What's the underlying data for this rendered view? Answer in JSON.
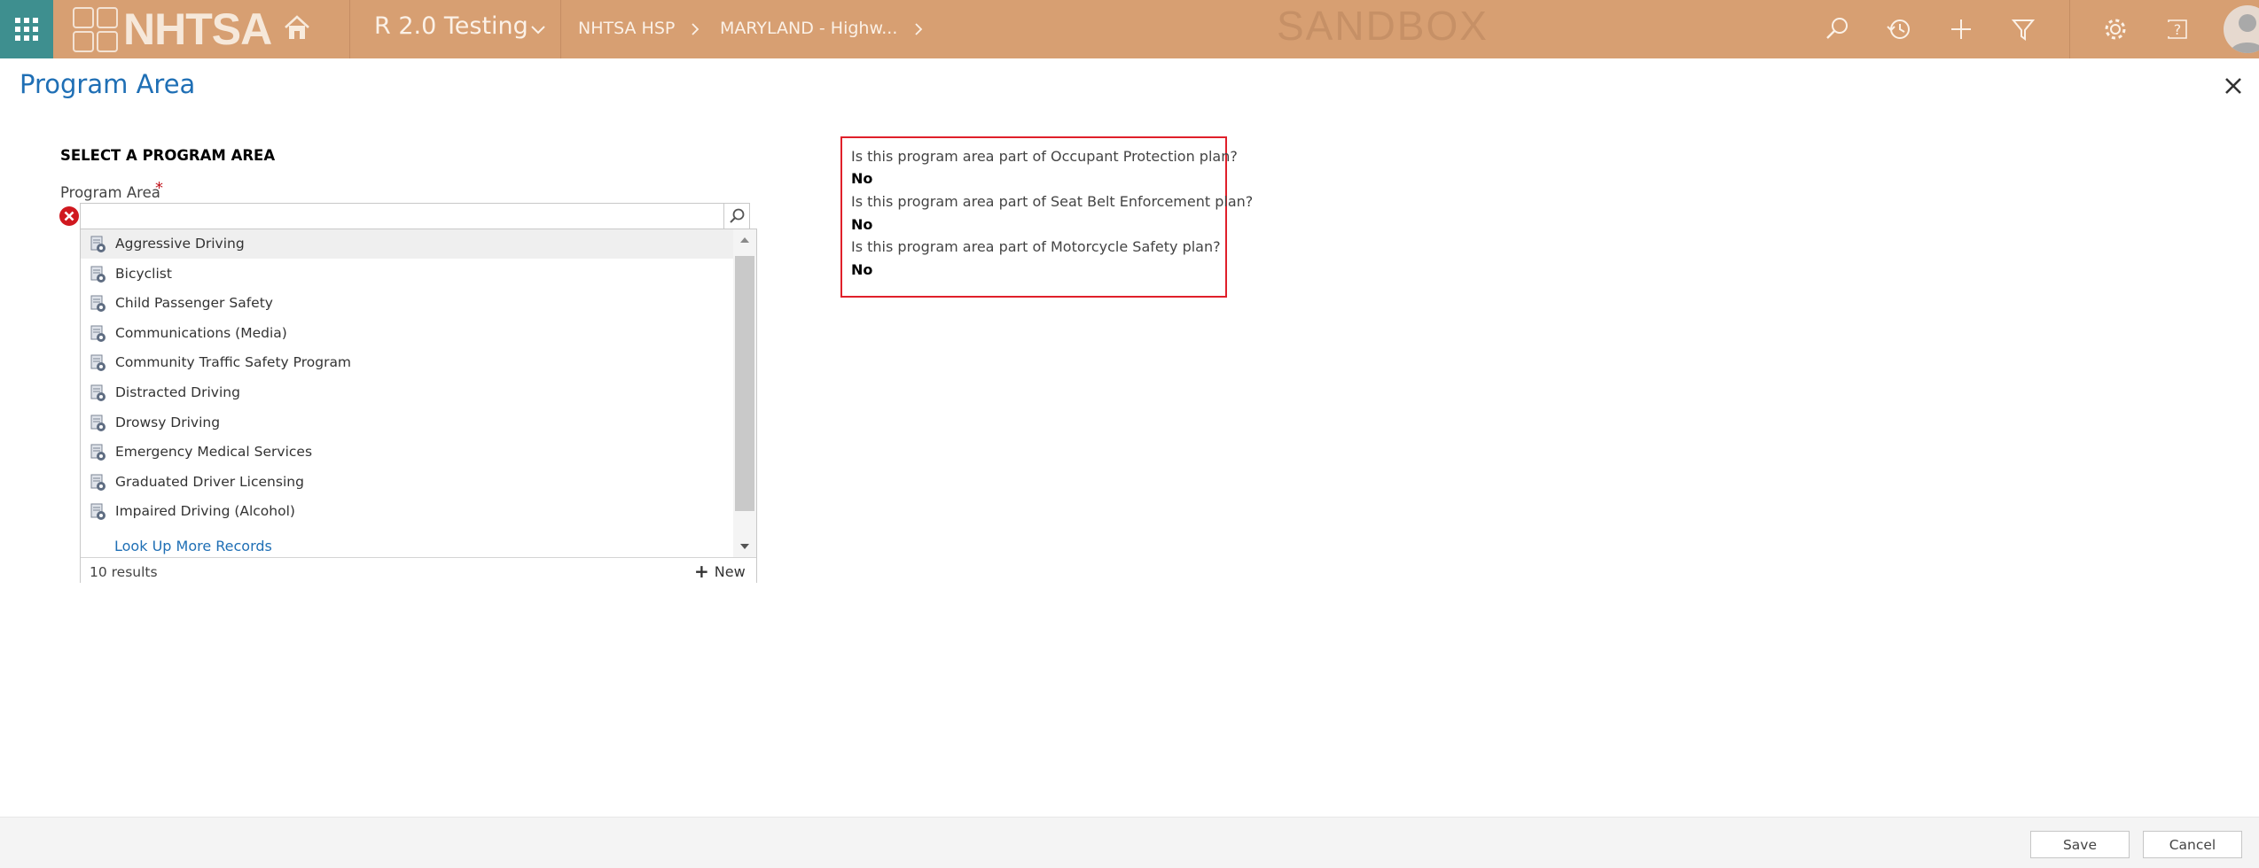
{
  "topbar": {
    "logo_text": "NHTSA",
    "app_title": "R 2.0 Testing",
    "breadcrumbs": [
      "NHTSA HSP",
      "MARYLAND - Highw..."
    ],
    "sandbox_label": "SANDBOX"
  },
  "dialog": {
    "title": "Program Area"
  },
  "form": {
    "section_heading": "SELECT A PROGRAM AREA",
    "field_label": "Program Area",
    "required_marker": "*",
    "input_value": ""
  },
  "lookup": {
    "items": [
      "Aggressive Driving",
      "Bicyclist",
      "Child Passenger Safety",
      "Communications (Media)",
      "Community Traffic Safety Program",
      "Distracted Driving",
      "Drowsy Driving",
      "Emergency Medical Services",
      "Graduated Driver Licensing",
      "Impaired Driving (Alcohol)"
    ],
    "look_up_more": "Look Up More Records",
    "results_count": "10 results",
    "new_label": "New"
  },
  "info": {
    "questions": [
      {
        "question": "Is this program area part of Occupant Protection plan?",
        "answer": "No"
      },
      {
        "question": "Is this program area part of Seat Belt Enforcement plan?",
        "answer": "No"
      },
      {
        "question": "Is this program area part of Motorcycle Safety plan?",
        "answer": "No"
      }
    ]
  },
  "footer": {
    "save_label": "Save",
    "cancel_label": "Cancel"
  },
  "colors": {
    "topbar": "#d79f72",
    "waffle": "#3e8f8f",
    "title_blue": "#1f6fb5",
    "highlight_border": "#e0202a",
    "error_red": "#d0181f"
  },
  "icons": {
    "waffle": "app-launcher-icon",
    "home": "home-icon",
    "search": "search-icon",
    "history": "history-icon",
    "add": "plus-icon",
    "filter": "filter-icon",
    "settings": "gear-icon",
    "help": "help-icon",
    "avatar": "user-avatar-icon",
    "close": "close-icon",
    "error": "error-icon",
    "entity": "entity-record-icon"
  }
}
